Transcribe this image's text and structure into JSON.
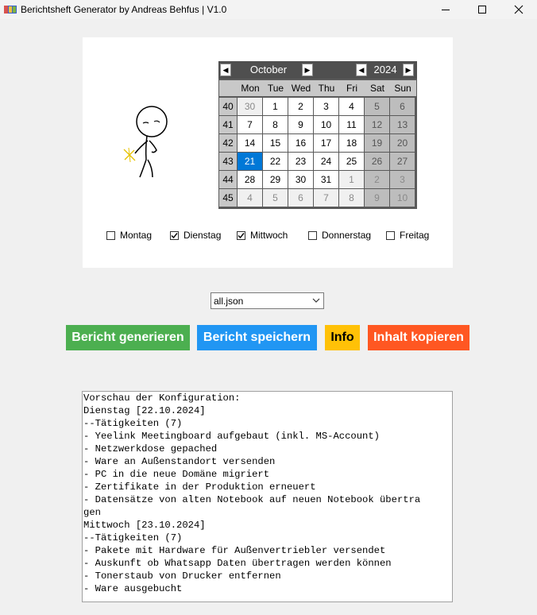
{
  "window": {
    "title": "Berichtsheft Generator by Andreas Behfus | V1.0"
  },
  "calendar": {
    "month": "October",
    "year": "2024",
    "weekdays": [
      "Mon",
      "Tue",
      "Wed",
      "Thu",
      "Fri",
      "Sat",
      "Sun"
    ],
    "weeks": [
      {
        "number": "40",
        "days": [
          {
            "d": "30",
            "t": "oth"
          },
          {
            "d": "1",
            "t": "cur"
          },
          {
            "d": "2",
            "t": "cur"
          },
          {
            "d": "3",
            "t": "cur"
          },
          {
            "d": "4",
            "t": "cur"
          },
          {
            "d": "5",
            "t": "we"
          },
          {
            "d": "6",
            "t": "we"
          }
        ]
      },
      {
        "number": "41",
        "days": [
          {
            "d": "7",
            "t": "cur"
          },
          {
            "d": "8",
            "t": "cur"
          },
          {
            "d": "9",
            "t": "cur"
          },
          {
            "d": "10",
            "t": "cur"
          },
          {
            "d": "11",
            "t": "cur"
          },
          {
            "d": "12",
            "t": "we"
          },
          {
            "d": "13",
            "t": "we"
          }
        ]
      },
      {
        "number": "42",
        "days": [
          {
            "d": "14",
            "t": "cur"
          },
          {
            "d": "15",
            "t": "cur"
          },
          {
            "d": "16",
            "t": "cur"
          },
          {
            "d": "17",
            "t": "cur"
          },
          {
            "d": "18",
            "t": "cur"
          },
          {
            "d": "19",
            "t": "we"
          },
          {
            "d": "20",
            "t": "we"
          }
        ]
      },
      {
        "number": "43",
        "days": [
          {
            "d": "21",
            "t": "sel"
          },
          {
            "d": "22",
            "t": "cur"
          },
          {
            "d": "23",
            "t": "cur"
          },
          {
            "d": "24",
            "t": "cur"
          },
          {
            "d": "25",
            "t": "cur"
          },
          {
            "d": "26",
            "t": "we"
          },
          {
            "d": "27",
            "t": "we"
          }
        ]
      },
      {
        "number": "44",
        "days": [
          {
            "d": "28",
            "t": "cur"
          },
          {
            "d": "29",
            "t": "cur"
          },
          {
            "d": "30",
            "t": "cur"
          },
          {
            "d": "31",
            "t": "cur"
          },
          {
            "d": "1",
            "t": "oth"
          },
          {
            "d": "2",
            "t": "wo"
          },
          {
            "d": "3",
            "t": "wo"
          }
        ]
      },
      {
        "number": "45",
        "days": [
          {
            "d": "4",
            "t": "oth"
          },
          {
            "d": "5",
            "t": "oth"
          },
          {
            "d": "6",
            "t": "oth"
          },
          {
            "d": "7",
            "t": "oth"
          },
          {
            "d": "8",
            "t": "oth"
          },
          {
            "d": "9",
            "t": "wo"
          },
          {
            "d": "10",
            "t": "wo"
          }
        ]
      }
    ],
    "selected_day": "21"
  },
  "weekday_checkboxes": [
    {
      "label": "Montag",
      "checked": false
    },
    {
      "label": "Dienstag",
      "checked": true
    },
    {
      "label": "Mittwoch",
      "checked": true
    },
    {
      "label": "Donnerstag",
      "checked": false
    },
    {
      "label": "Freitag",
      "checked": false
    }
  ],
  "config_select": {
    "value": "all.json"
  },
  "buttons": {
    "generate": {
      "label": "Bericht generieren",
      "color": "#4caf50"
    },
    "save": {
      "label": "Bericht speichern",
      "color": "#2196f3"
    },
    "info": {
      "label": "Info",
      "color": "#ffc107"
    },
    "copy": {
      "label": "Inhalt kopieren",
      "color": "#ff5722"
    }
  },
  "preview": {
    "lines": [
      "Vorschau der Konfiguration:",
      "Dienstag [22.10.2024]",
      "--Tätigkeiten (7)",
      "- Yeelink Meetingboard aufgebaut (inkl. MS-Account)",
      "- Netzwerkdose gepached",
      "- Ware an Außenstandort versenden",
      "- PC in die neue Domäne migriert",
      "- Zertifikate in der Produktion erneuert",
      "- Datensätze von alten Notebook auf neuen Notebook übertra",
      "gen",
      "Mittwoch [23.10.2024]",
      "--Tätigkeiten (7)",
      "- Pakete mit Hardware für Außenvertriebler versendet",
      "- Auskunft ob Whatsapp Daten übertragen werden können",
      "- Tonerstaub von Drucker entfernen",
      "- Ware ausgebucht"
    ]
  }
}
